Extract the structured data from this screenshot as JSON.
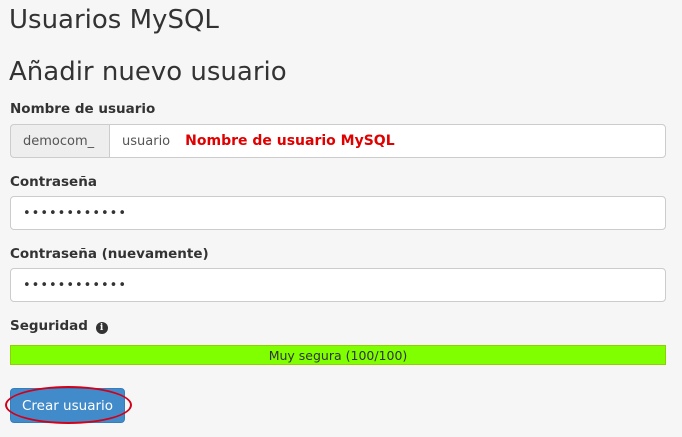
{
  "header": {
    "page_title": "Usuarios MySQL",
    "section_title": "Añadir nuevo usuario"
  },
  "form": {
    "username": {
      "label": "Nombre de usuario",
      "prefix": "democom_",
      "value": "usuario",
      "annotation": "Nombre de usuario MySQL"
    },
    "password": {
      "label": "Contraseña",
      "value": "••••••••••••"
    },
    "password_confirm": {
      "label": "Contraseña (nuevamente)",
      "value": "••••••••••••"
    },
    "strength": {
      "label": "Seguridad",
      "info_icon": "info-circle-icon",
      "text": "Muy segura (100/100)",
      "value": 100,
      "max": 100
    },
    "submit_label": "Crear usuario"
  },
  "colors": {
    "background": "#f6f6f6",
    "strength_fill": "#7fff00",
    "button": "#428bca",
    "annotation": "#e00000",
    "highlight_ring": "#d0021b"
  }
}
